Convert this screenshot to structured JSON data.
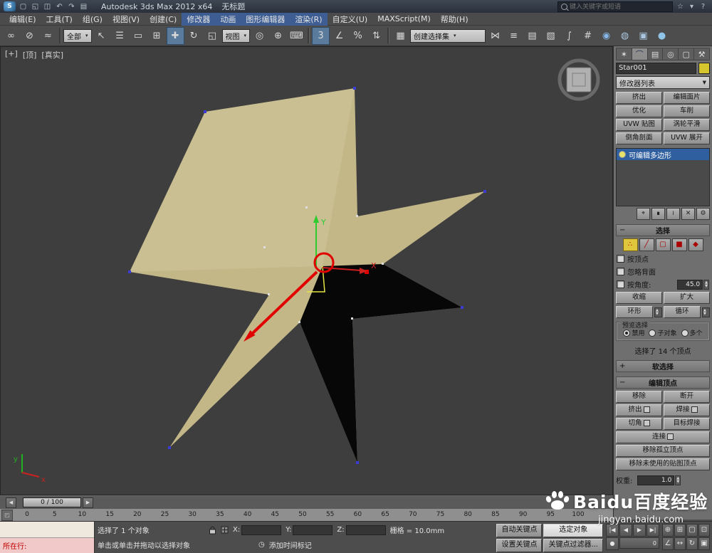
{
  "titlebar": {
    "logo": "S",
    "title": "Autodesk 3ds Max 2012 x64",
    "doc_title": "无标题",
    "search_placeholder": "键入关键字或短语",
    "qat": [
      {
        "name": "new-scene-icon",
        "glyph": "▢"
      },
      {
        "name": "open-file-icon",
        "glyph": "◱"
      },
      {
        "name": "save-file-icon",
        "glyph": "◫"
      },
      {
        "name": "undo-icon",
        "glyph": "↶"
      },
      {
        "name": "redo-icon",
        "glyph": "↷"
      },
      {
        "name": "project-folder-icon",
        "glyph": "▤"
      }
    ],
    "right_icons": [
      {
        "name": "favorites-star-icon",
        "glyph": "☆"
      },
      {
        "name": "communication-center-icon",
        "glyph": "▾"
      },
      {
        "name": "help-icon",
        "glyph": "?"
      }
    ]
  },
  "menu": {
    "items": [
      {
        "name": "menu-edit",
        "label": "编辑(E)"
      },
      {
        "name": "menu-tools",
        "label": "工具(T)"
      },
      {
        "name": "menu-group",
        "label": "组(G)"
      },
      {
        "name": "menu-views",
        "label": "视图(V)"
      },
      {
        "name": "menu-create",
        "label": "创建(C)"
      },
      {
        "name": "menu-modifiers",
        "label": "修改器",
        "highlighted": true
      },
      {
        "name": "menu-animation",
        "label": "动画",
        "highlighted": true
      },
      {
        "name": "menu-graph-editors",
        "label": "图形编辑器",
        "highlighted": true
      },
      {
        "name": "menu-rendering",
        "label": "渲染(R)",
        "highlighted": true
      },
      {
        "name": "menu-customize",
        "label": "自定义(U)"
      },
      {
        "name": "menu-maxscript",
        "label": "MAXScript(M)"
      },
      {
        "name": "menu-help",
        "label": "帮助(H)"
      }
    ]
  },
  "toolbar": {
    "items": [
      {
        "type": "icon",
        "name": "select-and-link-icon",
        "glyph": "∞"
      },
      {
        "type": "icon",
        "name": "unlink-selection-icon",
        "glyph": "⊘"
      },
      {
        "type": "icon",
        "name": "bind-to-space-warp-icon",
        "glyph": "≈"
      },
      {
        "type": "divider"
      },
      {
        "type": "dropdown",
        "name": "selection-filter-dropdown",
        "label": "全部"
      },
      {
        "type": "icon",
        "name": "select-object-icon",
        "glyph": "↖"
      },
      {
        "type": "icon",
        "name": "select-by-name-icon",
        "glyph": "☰"
      },
      {
        "type": "icon",
        "name": "rectangular-selection-region-icon",
        "glyph": "▭"
      },
      {
        "type": "icon",
        "name": "window-crossing-icon",
        "glyph": "⊞"
      },
      {
        "type": "icon",
        "name": "select-and-move-icon",
        "glyph": "✚",
        "active": true
      },
      {
        "type": "icon",
        "name": "select-and-rotate-icon",
        "glyph": "↻"
      },
      {
        "type": "icon",
        "name": "select-and-scale-icon",
        "glyph": "◱"
      },
      {
        "type": "dropdown",
        "name": "reference-coordinate-dropdown",
        "label": "视图"
      },
      {
        "type": "icon",
        "name": "use-pivot-point-center-icon",
        "glyph": "◎"
      },
      {
        "type": "icon",
        "name": "select-and-manipulate-icon",
        "glyph": "⊕"
      },
      {
        "type": "icon",
        "name": "keyboard-shortcut-override-icon",
        "glyph": "⌨"
      },
      {
        "type": "divider"
      },
      {
        "type": "icon",
        "name": "snaps-toggle-icon",
        "glyph": "3",
        "active": true
      },
      {
        "type": "icon",
        "name": "angle-snap-icon",
        "glyph": "∠"
      },
      {
        "type": "icon",
        "name": "percent-snap-icon",
        "glyph": "%"
      },
      {
        "type": "icon",
        "name": "spinner-snap-icon",
        "glyph": "⇅"
      },
      {
        "type": "divider"
      },
      {
        "type": "icon",
        "name": "edit-named-selection-sets-icon",
        "glyph": "▦"
      },
      {
        "type": "dropdown",
        "name": "named-selection-sets-dropdown",
        "label": "创建选择集",
        "wide": true
      },
      {
        "type": "icon",
        "name": "mirror-icon",
        "glyph": "⋈"
      },
      {
        "type": "icon",
        "name": "align-icon",
        "glyph": "≡"
      },
      {
        "type": "icon",
        "name": "layer-manager-icon",
        "glyph": "▤"
      },
      {
        "type": "icon",
        "name": "graphite-ribbon-icon",
        "glyph": "▧"
      },
      {
        "type": "icon",
        "name": "curve-editor-icon",
        "glyph": "∫"
      },
      {
        "type": "icon",
        "name": "schematic-view-icon",
        "glyph": "#"
      },
      {
        "type": "icon",
        "name": "material-editor-icon",
        "glyph": "◉",
        "color": "#86b7e8"
      },
      {
        "type": "icon",
        "name": "render-setup-icon",
        "glyph": "◍",
        "color": "#a9c6de"
      },
      {
        "type": "icon",
        "name": "rendered-frame-window-icon",
        "glyph": "▣",
        "color": "#a9c6de"
      },
      {
        "type": "icon",
        "name": "render-production-icon",
        "glyph": "●",
        "color": "#8fc4e8"
      }
    ]
  },
  "viewport": {
    "label_general": "[+]",
    "label_view": "[顶]",
    "label_shading": "[真实]",
    "gizmo_x_label": "X",
    "gizmo_y_label": "Y",
    "axis_x_label": "x",
    "axis_y_label": "y"
  },
  "command_panel": {
    "tabs": [
      {
        "name": "tab-create",
        "glyph": "✶"
      },
      {
        "name": "tab-modify",
        "glyph": "⌒",
        "active": true
      },
      {
        "name": "tab-hierarchy",
        "glyph": "▤"
      },
      {
        "name": "tab-motion",
        "glyph": "◎"
      },
      {
        "name": "tab-display",
        "glyph": "▢"
      },
      {
        "name": "tab-utilities",
        "glyph": "⚒"
      }
    ],
    "object_name": "Star001",
    "modifier_list_label": "修改器列表",
    "modifier_buttons": [
      {
        "name": "modifier-extrude-button",
        "label": "挤出"
      },
      {
        "name": "modifier-edit-patch-button",
        "label": "编辑面片"
      },
      {
        "name": "modifier-optimize-button",
        "label": "优化"
      },
      {
        "name": "modifier-lathe-button",
        "label": "车削"
      },
      {
        "name": "modifier-uvw-map-button",
        "label": "UVW 贴图"
      },
      {
        "name": "modifier-turbosmooth-button",
        "label": "涡轮平滑"
      },
      {
        "name": "modifier-bevel-profile-button",
        "label": "倒角剖面"
      },
      {
        "name": "modifier-unwrap-uvw-button",
        "label": "UVW 展开"
      }
    ],
    "stack_selected": "可编辑多边形",
    "stack_tools": [
      {
        "name": "pin-stack-icon",
        "glyph": "⌖"
      },
      {
        "name": "show-end-result-icon",
        "glyph": "∎"
      },
      {
        "name": "make-unique-icon",
        "glyph": "≀"
      },
      {
        "name": "remove-modifier-icon",
        "glyph": "✕"
      },
      {
        "name": "configure-modifier-sets-icon",
        "glyph": "⚙"
      }
    ],
    "selection": {
      "title": "选择",
      "subobject": [
        {
          "name": "vertex-mode-icon",
          "glyph": "∴",
          "active": true
        },
        {
          "name": "edge-mode-icon",
          "glyph": "╱"
        },
        {
          "name": "border-mode-icon",
          "glyph": "▢"
        },
        {
          "name": "polygon-mode-icon",
          "glyph": "■"
        },
        {
          "name": "element-mode-icon",
          "glyph": "◆"
        }
      ],
      "cb_by_vertex": "按顶点",
      "cb_ignore_backfacing": "忽略背面",
      "cb_by_angle": "按角度:",
      "angle_value": "45.0",
      "shrink": "收缩",
      "grow": "扩大",
      "ring": "环形",
      "loop": "循环",
      "preview_title": "预览选择",
      "radios": [
        {
          "name": "preview-disable-radio",
          "label": "禁用",
          "selected": true
        },
        {
          "name": "preview-subobject-radio",
          "label": "子对象",
          "selected": false
        },
        {
          "name": "preview-multiple-radio",
          "label": "多个",
          "selected": false
        }
      ],
      "status": "选择了 14 个顶点"
    },
    "soft_selection_title": "软选择",
    "edit_vertices": {
      "title": "编辑顶点",
      "pair_buttons": [
        {
          "name": "remove-vertex-button",
          "label": "移除"
        },
        {
          "name": "break-vertex-button",
          "label": "断开"
        },
        {
          "name": "extrude-vertex-button",
          "label": "挤出",
          "settings": true
        },
        {
          "name": "weld-vertex-button",
          "label": "焊接",
          "settings": true
        },
        {
          "name": "chamfer-vertex-button",
          "label": "切角",
          "settings": true
        },
        {
          "name": "target-weld-button",
          "label": "目标焊接"
        }
      ],
      "wide_buttons": [
        {
          "name": "connect-button",
          "label": "连接",
          "settings": true
        },
        {
          "name": "remove-isolated-vertices-button",
          "label": "移除孤立顶点"
        },
        {
          "name": "remove-unused-map-verts-button",
          "label": "移除未使用的贴图顶点"
        }
      ],
      "weight_label": "权重:",
      "weight_value": "1.0"
    }
  },
  "timeline": {
    "slider_label": "0 / 100",
    "ruler": [
      "0",
      "5",
      "10",
      "15",
      "20",
      "25",
      "30",
      "35",
      "40",
      "45",
      "50",
      "55",
      "60",
      "65",
      "70",
      "75",
      "80",
      "85",
      "90",
      "95",
      "100"
    ]
  },
  "statusbar": {
    "listener_prompt": "所在行:",
    "status_line": "选择了 1 个对象",
    "prompt_line": "单击或单击并拖动以选择对象",
    "coords": {
      "x_label": "X:",
      "y_label": "Y:",
      "z_label": "Z:",
      "x": "",
      "y": "",
      "z": ""
    },
    "grid_label": "栅格 = 10.0mm",
    "time_tag": "添加时间标记",
    "time_tag_icon": "◷",
    "auto_key": "自动关键点",
    "selected_mode": "选定对象",
    "set_key": "设置关键点",
    "key_filters": "关键点过滤器...",
    "frame": "0",
    "transport": [
      {
        "name": "go-to-start-icon",
        "glyph": "|◀"
      },
      {
        "name": "previous-frame-icon",
        "glyph": "◀"
      },
      {
        "name": "play-icon",
        "glyph": "▶"
      },
      {
        "name": "go-to-end-icon",
        "glyph": "▶|"
      },
      {
        "name": "key-mode-toggle-icon",
        "glyph": "●"
      }
    ],
    "nav": [
      {
        "name": "zoom-icon",
        "glyph": "⊕"
      },
      {
        "name": "zoom-all-icon",
        "glyph": "⊞"
      },
      {
        "name": "zoom-extents-icon",
        "glyph": "▢"
      },
      {
        "name": "zoom-extents-all-icon",
        "glyph": "⊡"
      },
      {
        "name": "field-of-view-icon",
        "glyph": "∠"
      },
      {
        "name": "pan-icon",
        "glyph": "↔"
      },
      {
        "name": "orbit-icon",
        "glyph": "↻"
      },
      {
        "name": "maximize-viewport-icon",
        "glyph": "▣"
      }
    ]
  },
  "watermark": {
    "brand": "Baidu",
    "brand_cn": "百度经验",
    "url": "jingyan.baidu.com"
  }
}
